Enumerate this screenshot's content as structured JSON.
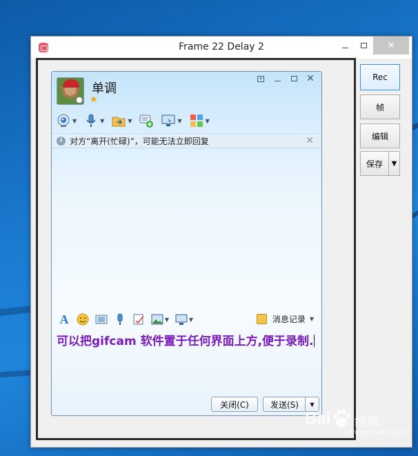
{
  "gifcam": {
    "title": "Frame 22 Delay 2",
    "buttons": {
      "rec": "Rec",
      "frame": "帧",
      "edit": "编辑",
      "save": "保存"
    }
  },
  "qq": {
    "contact_name": "单调",
    "notice": "对方“离开(忙碌)”，可能无法立即回复",
    "history_link": "消息记录",
    "input_text": "可以把gifcam 软件置于任何界面上方,便于录制.",
    "close_button": "关闭(C)",
    "send_button": "发送(S)"
  },
  "watermark": {
    "text": "经验",
    "url": "jingyan.baidu.com"
  },
  "icons": {
    "toolbar": [
      "webcam-icon",
      "microphone-icon",
      "file-transfer-icon",
      "chat-add-icon",
      "screen-share-icon",
      "apps-icon"
    ],
    "input_toolbar": [
      "font-icon",
      "emoji-icon",
      "film-icon",
      "voice-icon",
      "note-icon",
      "image-icon",
      "screenshot-icon"
    ]
  }
}
